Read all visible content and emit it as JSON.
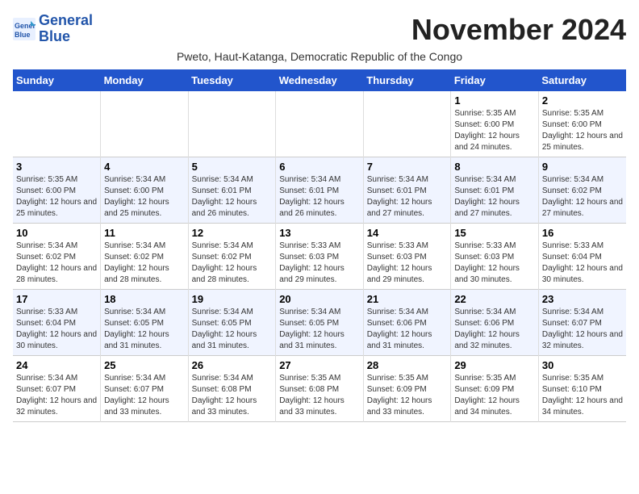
{
  "logo": {
    "line1": "General",
    "line2": "Blue"
  },
  "title": "November 2024",
  "subtitle": "Pweto, Haut-Katanga, Democratic Republic of the Congo",
  "weekdays": [
    "Sunday",
    "Monday",
    "Tuesday",
    "Wednesday",
    "Thursday",
    "Friday",
    "Saturday"
  ],
  "weeks": [
    [
      {
        "day": "",
        "info": ""
      },
      {
        "day": "",
        "info": ""
      },
      {
        "day": "",
        "info": ""
      },
      {
        "day": "",
        "info": ""
      },
      {
        "day": "",
        "info": ""
      },
      {
        "day": "1",
        "info": "Sunrise: 5:35 AM\nSunset: 6:00 PM\nDaylight: 12 hours and 24 minutes."
      },
      {
        "day": "2",
        "info": "Sunrise: 5:35 AM\nSunset: 6:00 PM\nDaylight: 12 hours and 25 minutes."
      }
    ],
    [
      {
        "day": "3",
        "info": "Sunrise: 5:35 AM\nSunset: 6:00 PM\nDaylight: 12 hours and 25 minutes."
      },
      {
        "day": "4",
        "info": "Sunrise: 5:34 AM\nSunset: 6:00 PM\nDaylight: 12 hours and 25 minutes."
      },
      {
        "day": "5",
        "info": "Sunrise: 5:34 AM\nSunset: 6:01 PM\nDaylight: 12 hours and 26 minutes."
      },
      {
        "day": "6",
        "info": "Sunrise: 5:34 AM\nSunset: 6:01 PM\nDaylight: 12 hours and 26 minutes."
      },
      {
        "day": "7",
        "info": "Sunrise: 5:34 AM\nSunset: 6:01 PM\nDaylight: 12 hours and 27 minutes."
      },
      {
        "day": "8",
        "info": "Sunrise: 5:34 AM\nSunset: 6:01 PM\nDaylight: 12 hours and 27 minutes."
      },
      {
        "day": "9",
        "info": "Sunrise: 5:34 AM\nSunset: 6:02 PM\nDaylight: 12 hours and 27 minutes."
      }
    ],
    [
      {
        "day": "10",
        "info": "Sunrise: 5:34 AM\nSunset: 6:02 PM\nDaylight: 12 hours and 28 minutes."
      },
      {
        "day": "11",
        "info": "Sunrise: 5:34 AM\nSunset: 6:02 PM\nDaylight: 12 hours and 28 minutes."
      },
      {
        "day": "12",
        "info": "Sunrise: 5:34 AM\nSunset: 6:02 PM\nDaylight: 12 hours and 28 minutes."
      },
      {
        "day": "13",
        "info": "Sunrise: 5:33 AM\nSunset: 6:03 PM\nDaylight: 12 hours and 29 minutes."
      },
      {
        "day": "14",
        "info": "Sunrise: 5:33 AM\nSunset: 6:03 PM\nDaylight: 12 hours and 29 minutes."
      },
      {
        "day": "15",
        "info": "Sunrise: 5:33 AM\nSunset: 6:03 PM\nDaylight: 12 hours and 30 minutes."
      },
      {
        "day": "16",
        "info": "Sunrise: 5:33 AM\nSunset: 6:04 PM\nDaylight: 12 hours and 30 minutes."
      }
    ],
    [
      {
        "day": "17",
        "info": "Sunrise: 5:33 AM\nSunset: 6:04 PM\nDaylight: 12 hours and 30 minutes."
      },
      {
        "day": "18",
        "info": "Sunrise: 5:34 AM\nSunset: 6:05 PM\nDaylight: 12 hours and 31 minutes."
      },
      {
        "day": "19",
        "info": "Sunrise: 5:34 AM\nSunset: 6:05 PM\nDaylight: 12 hours and 31 minutes."
      },
      {
        "day": "20",
        "info": "Sunrise: 5:34 AM\nSunset: 6:05 PM\nDaylight: 12 hours and 31 minutes."
      },
      {
        "day": "21",
        "info": "Sunrise: 5:34 AM\nSunset: 6:06 PM\nDaylight: 12 hours and 31 minutes."
      },
      {
        "day": "22",
        "info": "Sunrise: 5:34 AM\nSunset: 6:06 PM\nDaylight: 12 hours and 32 minutes."
      },
      {
        "day": "23",
        "info": "Sunrise: 5:34 AM\nSunset: 6:07 PM\nDaylight: 12 hours and 32 minutes."
      }
    ],
    [
      {
        "day": "24",
        "info": "Sunrise: 5:34 AM\nSunset: 6:07 PM\nDaylight: 12 hours and 32 minutes."
      },
      {
        "day": "25",
        "info": "Sunrise: 5:34 AM\nSunset: 6:07 PM\nDaylight: 12 hours and 33 minutes."
      },
      {
        "day": "26",
        "info": "Sunrise: 5:34 AM\nSunset: 6:08 PM\nDaylight: 12 hours and 33 minutes."
      },
      {
        "day": "27",
        "info": "Sunrise: 5:35 AM\nSunset: 6:08 PM\nDaylight: 12 hours and 33 minutes."
      },
      {
        "day": "28",
        "info": "Sunrise: 5:35 AM\nSunset: 6:09 PM\nDaylight: 12 hours and 33 minutes."
      },
      {
        "day": "29",
        "info": "Sunrise: 5:35 AM\nSunset: 6:09 PM\nDaylight: 12 hours and 34 minutes."
      },
      {
        "day": "30",
        "info": "Sunrise: 5:35 AM\nSunset: 6:10 PM\nDaylight: 12 hours and 34 minutes."
      }
    ]
  ]
}
